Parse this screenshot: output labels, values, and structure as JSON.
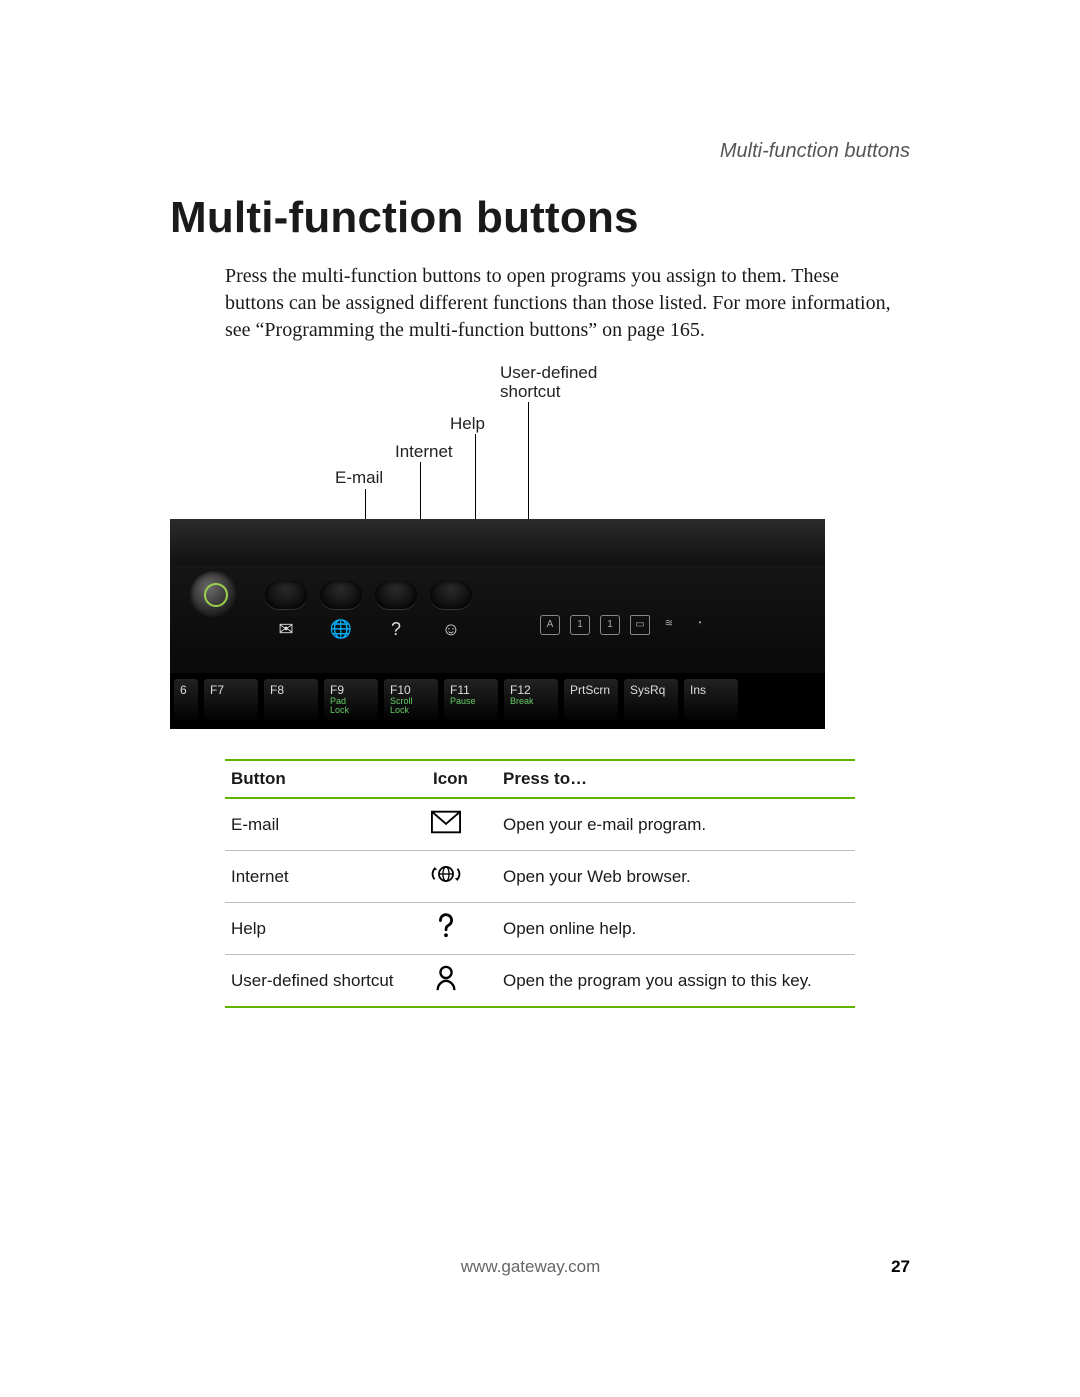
{
  "running_head": "Multi-function buttons",
  "title": "Multi-function buttons",
  "body": "Press the multi-function buttons to open programs you assign to them. These buttons can be assigned different functions than those listed. For more information, see “Programming the multi-function buttons” on page 165.",
  "annotation_labels": {
    "email": "E-mail",
    "internet": "Internet",
    "help": "Help",
    "user_defined": "User-defined shortcut"
  },
  "photo_keys": [
    "6",
    "F7",
    "F8",
    "F9",
    "F10",
    "F11",
    "F12",
    "PrtScrn",
    "SysRq",
    "Ins"
  ],
  "photo_key_subs": {
    "F9": "Pad Lock",
    "F10": "Scroll Lock",
    "F11": "Pause",
    "F12": "Break"
  },
  "table": {
    "headers": {
      "button": "Button",
      "icon": "Icon",
      "press": "Press to…"
    },
    "rows": [
      {
        "button": "E-mail",
        "icon": "mail",
        "press": "Open your e-mail program."
      },
      {
        "button": "Internet",
        "icon": "globe",
        "press": "Open your Web browser."
      },
      {
        "button": "Help",
        "icon": "help",
        "press": "Open online help."
      },
      {
        "button": "User-defined shortcut",
        "icon": "user",
        "press": "Open the program you assign to this key."
      }
    ]
  },
  "footer": {
    "site": "www.gateway.com",
    "page": "27"
  }
}
